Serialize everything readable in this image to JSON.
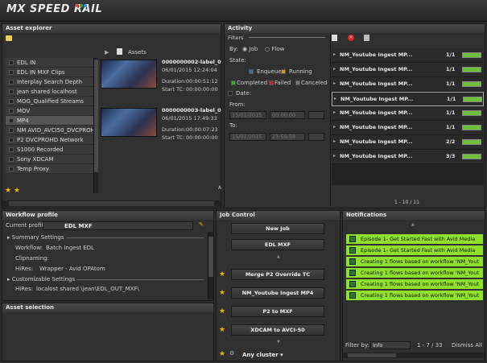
{
  "app": {
    "logo": "MX SPEED RAIL"
  },
  "asset_explorer": {
    "title": "Asset explorer",
    "breadcrumb": "Assets",
    "tree": [
      "EDL IN",
      "EDL IN MXF Clips",
      "Interplay Search Depth",
      "jean shared localhost",
      "MOG_Qualified Streams",
      "MOV",
      "MP4",
      "NM AVID_AVCI50_DVCPROHD",
      "P2 DVCPROHD Network",
      "S1000 Recorded",
      "Sony XDCAM",
      "Temp Proxy"
    ],
    "assets": [
      {
        "name": "0000000002-label_00",
        "date": "06/01/2015 12:24:04",
        "duration_label": "Duration:",
        "duration": "00:00:51:12",
        "start_label": "Start TC:",
        "start": "00:00:00:00"
      },
      {
        "name": "0000000003-label_00",
        "date": "06/01/2015 17:49:33",
        "duration_label": "Duration:",
        "duration": "00:00:07:23",
        "start_label": "Start TC:",
        "start": "00:00:00:00"
      }
    ],
    "letter": "A"
  },
  "activity": {
    "title": "Activity",
    "filters_label": "Filters",
    "by_label": "By:",
    "job_label": "Job",
    "flow_label": "Flow",
    "state_label": "State:",
    "enqueued": "Enqueued",
    "running": "Running",
    "completed": "Completed",
    "failed": "Failed",
    "canceled": "Canceled",
    "date_label": "Date:",
    "from_label": "From:",
    "to_label": "To:",
    "from_date": "15/01/2015",
    "from_time": "00:00:00",
    "to_date": "15/01/2015",
    "to_time": "23:59:59",
    "pager": "1 - 10 / 11",
    "jobs": [
      {
        "name": "NM_Youtube Ingest MP...",
        "count": "1/1"
      },
      {
        "name": "NM_Youtube Ingest MP...",
        "count": "1/1"
      },
      {
        "name": "NM_Youtube Ingest MP...",
        "count": "1/1"
      },
      {
        "name": "NM_Youtube Ingest MP...",
        "count": "1/1"
      },
      {
        "name": "NM_Youtube Ingest MP...",
        "count": "1/1"
      },
      {
        "name": "NM_Youtube Ingest MP...",
        "count": "1/1"
      },
      {
        "name": "NM_Youtube Ingest MP...",
        "count": "2/2"
      },
      {
        "name": "NM_Youtube Ingest MP...",
        "count": "3/3"
      }
    ]
  },
  "workflow": {
    "title": "Workflow profile",
    "current_label": "Current profile:",
    "current": "EDL MXF",
    "summary": "Summary Settings",
    "workflow_label": "Workflow:",
    "workflow": "Batch Ingest EDL",
    "clip_label": "Clipnaming:",
    "hires_label": "HiRes:",
    "hires": "Wrapper -   Avid OPAtom",
    "custom": "Customizable Settings",
    "hires2_label": "HiRes:",
    "hires2": "localost shared   \\jean\\EDL_OUT_MXF\\"
  },
  "asset_selection": {
    "title": "Asset selection"
  },
  "job_control": {
    "title": "Job Control",
    "new_job": "New Job",
    "edl": "EDL MXF",
    "buttons": [
      "Merge P2 Override TC",
      "NM_Youtube Ingest MP4",
      "P2 to MXF",
      "XDCAM to AVCI-50"
    ],
    "cluster": "Any cluster"
  },
  "notifications": {
    "title": "Notifications",
    "items": [
      "Episode 1- Get Started Fast with Avid Media",
      "Episode 1- Get Started Fast with Avid Media",
      "Creating 1 flows based on workflow 'NM_Yout",
      "Creating 1 flows based on workflow 'NM_Yout",
      "Creating 1 flows based on workflow 'NM_Yout",
      "Creating 1 flows based on workflow 'NM_Yout"
    ],
    "filter_label": "Filter by:",
    "filter": "Info",
    "pager": "1 - 7 / 33",
    "dismiss": "Dismiss All"
  }
}
